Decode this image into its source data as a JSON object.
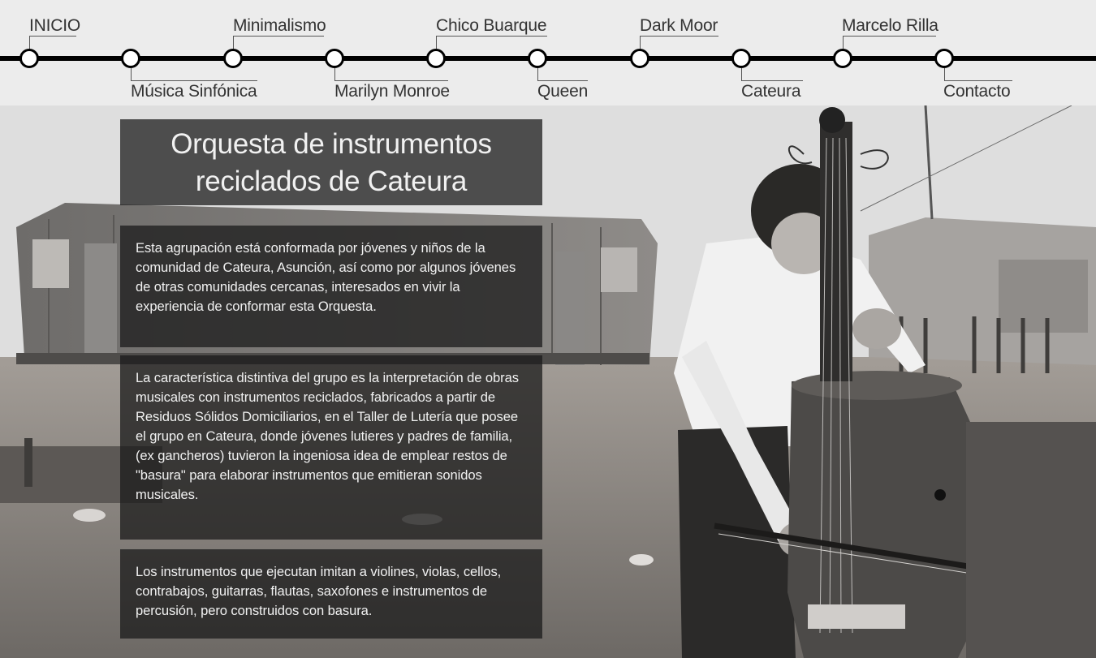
{
  "nav": {
    "items": [
      {
        "label": "INICIO"
      },
      {
        "label": "Música Sinfónica"
      },
      {
        "label": "Minimalismo"
      },
      {
        "label": "Marilyn Monroe"
      },
      {
        "label": "Chico Buarque"
      },
      {
        "label": "Queen"
      },
      {
        "label": "Dark Moor"
      },
      {
        "label": "Cateura"
      },
      {
        "label": "Marcelo Rilla"
      },
      {
        "label": "Contacto"
      }
    ]
  },
  "article": {
    "title": "Orquesta de instrumentos reciclados de Cateura",
    "paragraphs": [
      "Esta agrupación está conformada por jóvenes y niños de la comunidad de Cateura, Asunción, así como por algunos jóvenes de otras comunidades cercanas, interesados en vivir la experiencia de conformar esta Orquesta.",
      "La característica distintiva del grupo es la interpretación de obras musicales con instrumentos reciclados, fabricados a partir de Residuos Sólidos Domiciliarios, en el Taller de Lutería que posee el grupo en Cateura, donde jóvenes lutieres y padres de familia, (ex gancheros) tuvieron la ingeniosa idea de emplear restos de \"basura\" para elaborar instrumentos que emitieran sonidos musicales.",
      "Los instrumentos que ejecutan imitan a violines, violas, cellos, contrabajos, guitarras, flautas, saxofones e instrumentos de percusión, pero construidos con basura."
    ]
  },
  "colors": {
    "rail": "#000000",
    "node_fill": "#ffffff",
    "panel_bg": "#191919",
    "page_bg": "#ececec"
  }
}
